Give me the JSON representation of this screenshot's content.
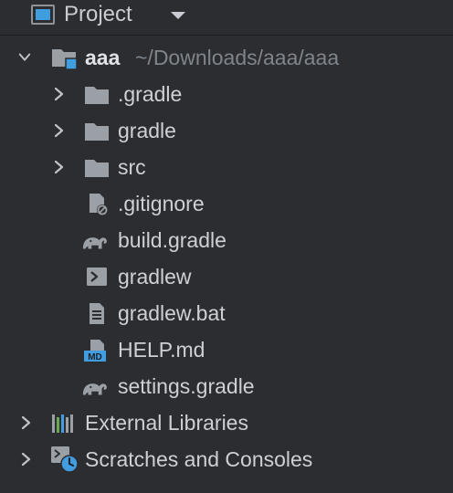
{
  "header": {
    "title": "Project"
  },
  "tree": {
    "root": {
      "name": "aaa",
      "path": "~/Downloads/aaa/aaa"
    },
    "children": [
      {
        "label": ".gradle",
        "icon": "folder-icon"
      },
      {
        "label": "gradle",
        "icon": "folder-icon"
      },
      {
        "label": "src",
        "icon": "folder-icon"
      },
      {
        "label": ".gitignore",
        "icon": "ignored-file-icon"
      },
      {
        "label": "build.gradle",
        "icon": "gradle-elephant-icon"
      },
      {
        "label": "gradlew",
        "icon": "shell-script-icon"
      },
      {
        "label": "gradlew.bat",
        "icon": "text-file-icon"
      },
      {
        "label": "HELP.md",
        "icon": "markdown-file-icon"
      },
      {
        "label": "settings.gradle",
        "icon": "gradle-elephant-icon"
      }
    ],
    "bottom": [
      {
        "label": "External Libraries",
        "icon": "libraries-icon"
      },
      {
        "label": "Scratches and Consoles",
        "icon": "scratches-icon"
      }
    ]
  },
  "colors": {
    "background": "#2b2d30",
    "text": "#cdd1d6",
    "muted": "#7f858c",
    "accent_blue": "#3f9de0"
  }
}
